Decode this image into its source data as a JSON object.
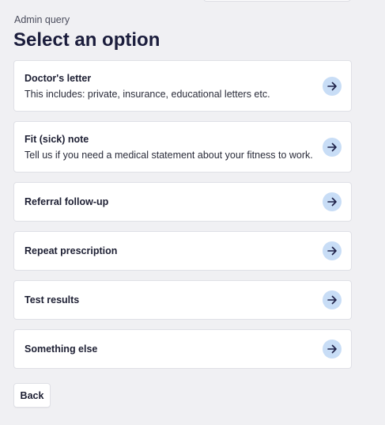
{
  "header": {
    "eyebrow": "Admin query",
    "title": "Select an option"
  },
  "options": [
    {
      "title": "Doctor's letter",
      "description": "This includes: private, insurance, educational letters etc."
    },
    {
      "title": "Fit (sick) note",
      "description": "Tell us if you need a medical statement about your fitness to work."
    },
    {
      "title": "Referral follow-up"
    },
    {
      "title": "Repeat prescription"
    },
    {
      "title": "Test results"
    },
    {
      "title": "Something else"
    }
  ],
  "footer": {
    "back_label": "Back"
  },
  "icons": {
    "option_arrow": "arrow-right-icon"
  },
  "colors": {
    "page_background": "#f0f0f3",
    "card_background": "#ffffff",
    "heading": "#1b1d3c",
    "arrow_circle": "#c8ddf6",
    "arrow_glyph": "#1e2148"
  }
}
